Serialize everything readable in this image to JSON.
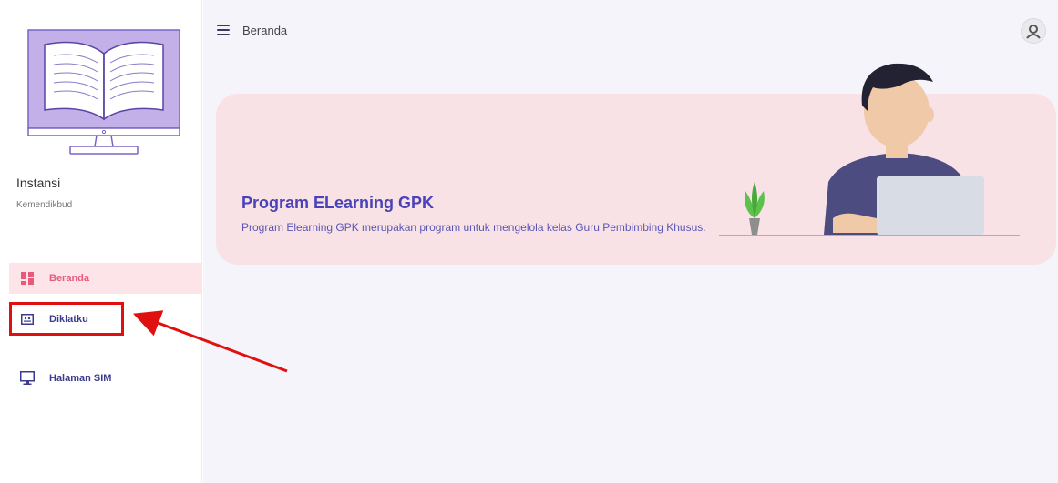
{
  "sidebar": {
    "institution_title": "Instansi",
    "institution_name": "Kemendikbud",
    "items": [
      {
        "label": "Beranda",
        "icon": "dashboard-icon",
        "active": true
      },
      {
        "label": "Diklatku",
        "icon": "classroom-icon",
        "active": false
      },
      {
        "label": "Halaman SIM",
        "icon": "monitor-icon",
        "active": false
      }
    ]
  },
  "header": {
    "title": "Beranda",
    "menu_icon": "hamburger-icon",
    "avatar_icon": "user-avatar-icon"
  },
  "banner": {
    "title": "Program ELearning GPK",
    "description": "Program Elearning GPK merupakan program untuk mengelola kelas Guru Pembimbing Khusus."
  },
  "colors": {
    "active_bg": "#fce4e8",
    "active_text": "#e75a7c",
    "nav_text": "#3b3b8f",
    "banner_bg": "#f8e2e6",
    "banner_title": "#4a43b8",
    "annotation_red": "#e01010"
  }
}
